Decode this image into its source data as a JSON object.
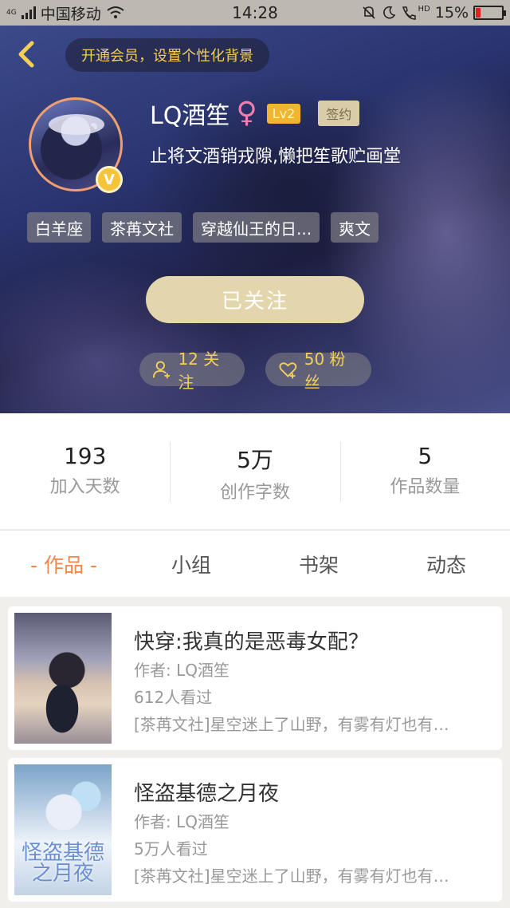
{
  "status_bar": {
    "network": "4G",
    "carrier": "中国移动",
    "time": "14:28",
    "hd": "HD",
    "battery": "15%",
    "battery_color": "#e02020"
  },
  "header": {
    "vip_banner": "开通会员，设置个性化背景"
  },
  "profile": {
    "username": "LQ酒笙",
    "gender_symbol": "♀",
    "level": "Lv2",
    "sign_badge": "签约",
    "vip_badge": "V",
    "bio": "止将文酒销戎隙,懒把笙歌贮画堂",
    "tags": [
      "白羊座",
      "茶苒文社",
      "穿越仙王的日...",
      "爽文"
    ],
    "follow_button": "已关注",
    "following": "12 关注",
    "fans": "50 粉丝"
  },
  "stats": [
    {
      "value": "193",
      "label": "加入天数"
    },
    {
      "value": "5万",
      "label": "创作字数"
    },
    {
      "value": "5",
      "label": "作品数量"
    }
  ],
  "tabs": [
    "- 作品 -",
    "小组",
    "书架",
    "动态"
  ],
  "works": [
    {
      "title": "快穿:我真的是恶毒女配？",
      "author": "作者: LQ酒笙",
      "views": "612人看过",
      "desc": "[茶苒文社]星空迷上了山野，有雾有灯也有…"
    },
    {
      "title": "怪盗基德之月夜",
      "author": "作者: LQ酒笙",
      "views": "5万人看过",
      "desc": "[茶苒文社]星空迷上了山野，有雾有灯也有…",
      "cover_text": "怪盗基德之月夜"
    }
  ],
  "colors": {
    "accent_orange": "#f2874a",
    "gold": "#f4cf58",
    "follow_button": "#e3d6ac"
  }
}
